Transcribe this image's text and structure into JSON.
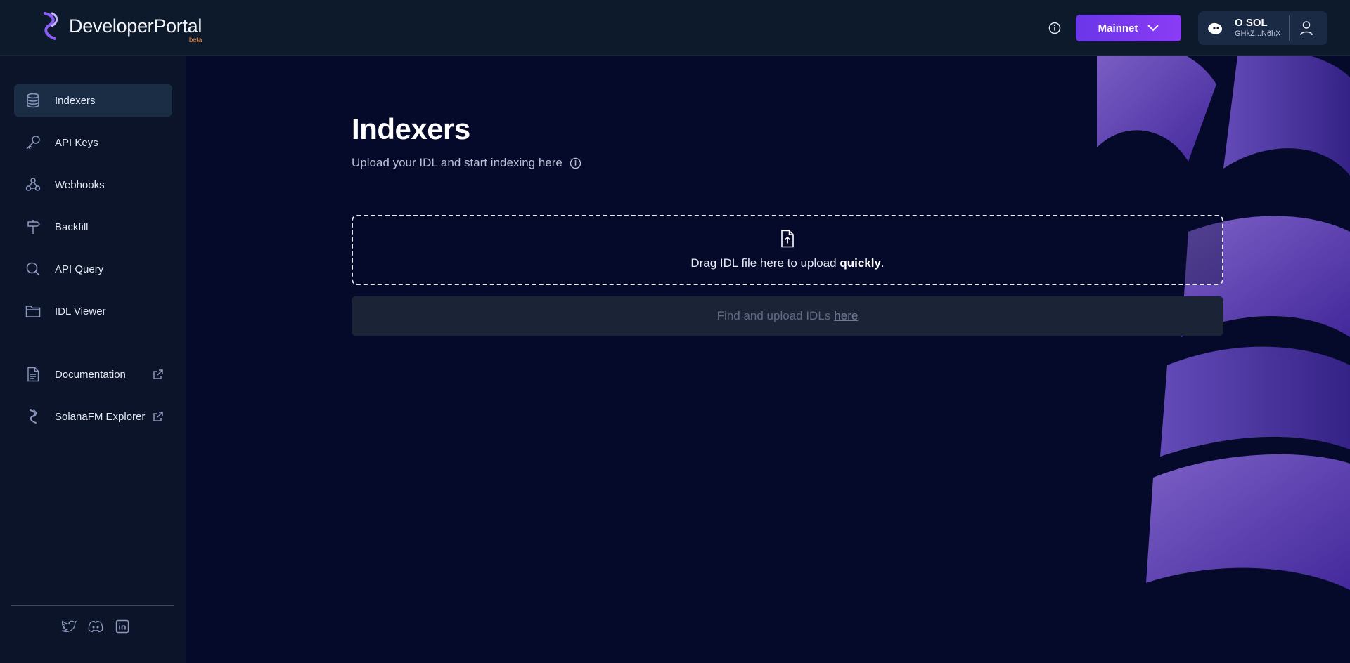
{
  "header": {
    "logo_text": "DeveloperPortal",
    "logo_badge": "beta",
    "network": "Mainnet",
    "wallet_balance": "O SOL",
    "wallet_address": "GHkZ...N6hX"
  },
  "sidebar": {
    "items": [
      {
        "label": "Indexers",
        "icon": "database-icon",
        "active": true
      },
      {
        "label": "API Keys",
        "icon": "key-icon"
      },
      {
        "label": "Webhooks",
        "icon": "webhook-icon"
      },
      {
        "label": "Backfill",
        "icon": "signpost-icon"
      },
      {
        "label": "API Query",
        "icon": "search-icon"
      },
      {
        "label": "IDL Viewer",
        "icon": "folder-icon"
      }
    ],
    "links": [
      {
        "label": "Documentation",
        "icon": "document-icon",
        "external": true
      },
      {
        "label": "SolanaFM Explorer",
        "icon": "solanafm-icon",
        "external": true
      }
    ],
    "social": [
      "twitter-icon",
      "discord-icon",
      "linkedin-icon"
    ]
  },
  "main": {
    "title": "Indexers",
    "subtitle": "Upload your IDL and start indexing here",
    "dropzone_text": "Drag IDL file here to upload ",
    "dropzone_bold": "quickly",
    "dropzone_end": ".",
    "find_text": "Find and upload IDLs",
    "find_link": "here"
  },
  "colors": {
    "accent": "#7a3aef",
    "background": "#050a2a",
    "sidebar": "#0b1428",
    "active_item": "#1a2d45"
  }
}
